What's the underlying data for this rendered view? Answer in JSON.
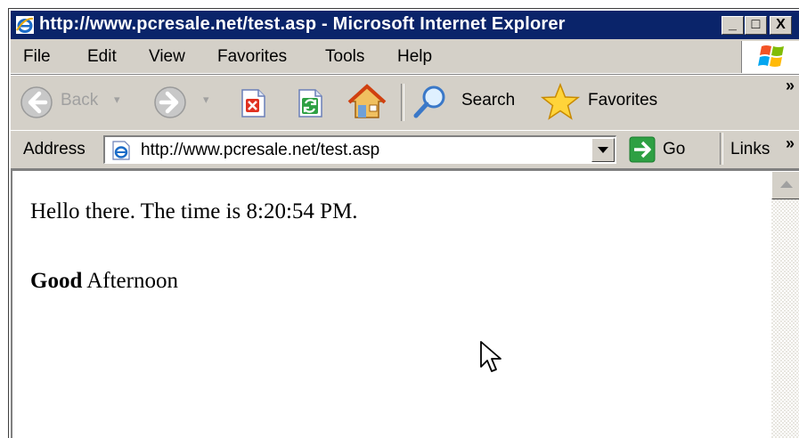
{
  "window": {
    "title": "http://www.pcresale.net/test.asp - Microsoft Internet Explorer",
    "minimize": "_",
    "maximize": "□",
    "close": "X"
  },
  "menu": {
    "file": "File",
    "edit": "Edit",
    "view": "View",
    "favorites": "Favorites",
    "tools": "Tools",
    "help": "Help"
  },
  "toolbar": {
    "back_label": "Back",
    "search_label": "Search",
    "favorites_label": "Favorites",
    "more": "»"
  },
  "address": {
    "label": "Address",
    "url": "http://www.pcresale.net/test.asp",
    "go_label": "Go",
    "links_label": "Links",
    "more": "»"
  },
  "page": {
    "line1": "Hello there. The time is 8:20:54 PM.",
    "line2_bold": "Good",
    "line2_rest": " Afternoon"
  },
  "colors": {
    "titlebar": "#0a246a",
    "chrome": "#d4d0c8"
  }
}
